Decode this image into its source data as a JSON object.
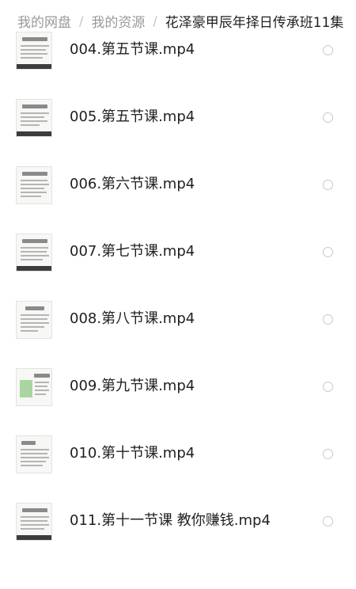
{
  "breadcrumb": {
    "items": [
      "我的网盘",
      "我的资源"
    ],
    "separator": "/",
    "current": "花泽豪甲辰年择日传承班11集"
  },
  "files": [
    {
      "name": "004.第五节课.mp4",
      "thumb_icon": "video-thumbnail-icon"
    },
    {
      "name": "005.第五节课.mp4",
      "thumb_icon": "video-thumbnail-icon"
    },
    {
      "name": "006.第六节课.mp4",
      "thumb_icon": "video-thumbnail-icon"
    },
    {
      "name": "007.第七节课.mp4",
      "thumb_icon": "video-thumbnail-icon"
    },
    {
      "name": "008.第八节课.mp4",
      "thumb_icon": "video-thumbnail-icon"
    },
    {
      "name": "009.第九节课.mp4",
      "thumb_icon": "video-thumbnail-icon"
    },
    {
      "name": "010.第十节课.mp4",
      "thumb_icon": "video-thumbnail-icon"
    },
    {
      "name": "011.第十一节课 教你赚钱.mp4",
      "thumb_icon": "video-thumbnail-icon"
    }
  ],
  "colors": {
    "crumb_inactive": "#9a9a9a",
    "text": "#1f1f1f",
    "radio_border": "#c8c8c8"
  }
}
